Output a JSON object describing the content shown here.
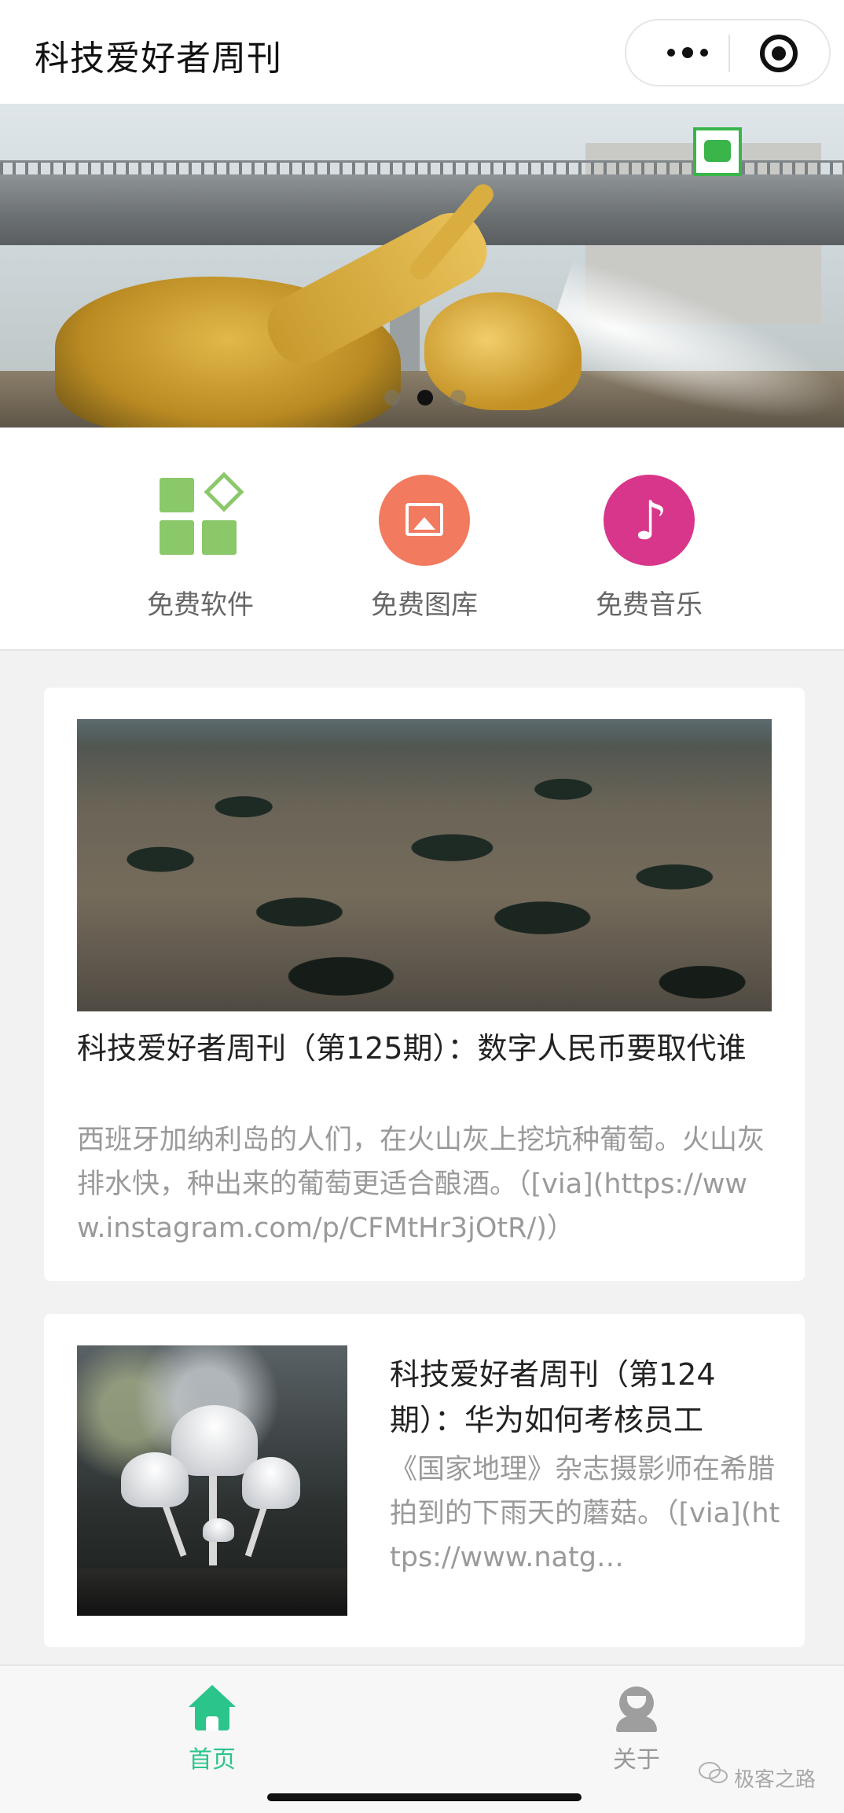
{
  "app": {
    "title": "科技爱好者周刊"
  },
  "header": {
    "more_icon": "more-dots-icon",
    "close_icon": "target-close-icon"
  },
  "banner": {
    "slide_count": 3,
    "active_index": 1
  },
  "quick_nav": [
    {
      "label": "免费软件",
      "icon": "apps-grid-icon",
      "color": "#8bc86a"
    },
    {
      "label": "免费图库",
      "icon": "image-icon",
      "color": "#f27a5e"
    },
    {
      "label": "免费音乐",
      "icon": "music-note-icon",
      "color": "#d8368a"
    }
  ],
  "articles": [
    {
      "title": "科技爱好者周刊（第125期）：数字人民币要取代谁",
      "description": "西班牙加纳利岛的人们，在火山灰上挖坑种葡萄。火山灰排水快，种出来的葡萄更适合酿酒。（[via](https://www.instagram.com/p/CFMtHr3jOtR/)）"
    },
    {
      "title": "科技爱好者周刊（第124期）：华为如何考核员工",
      "description": "《国家地理》杂志摄影师在希腊拍到的下雨天的蘑菇。（[via](https://www.natg…"
    }
  ],
  "tabbar": {
    "tabs": [
      {
        "label": "首页",
        "icon": "home-icon",
        "active": true
      },
      {
        "label": "关于",
        "icon": "user-icon",
        "active": false
      }
    ],
    "accent_color": "#2bc48a"
  },
  "watermark": {
    "text": "极客之路",
    "icon": "wechat-icon"
  }
}
